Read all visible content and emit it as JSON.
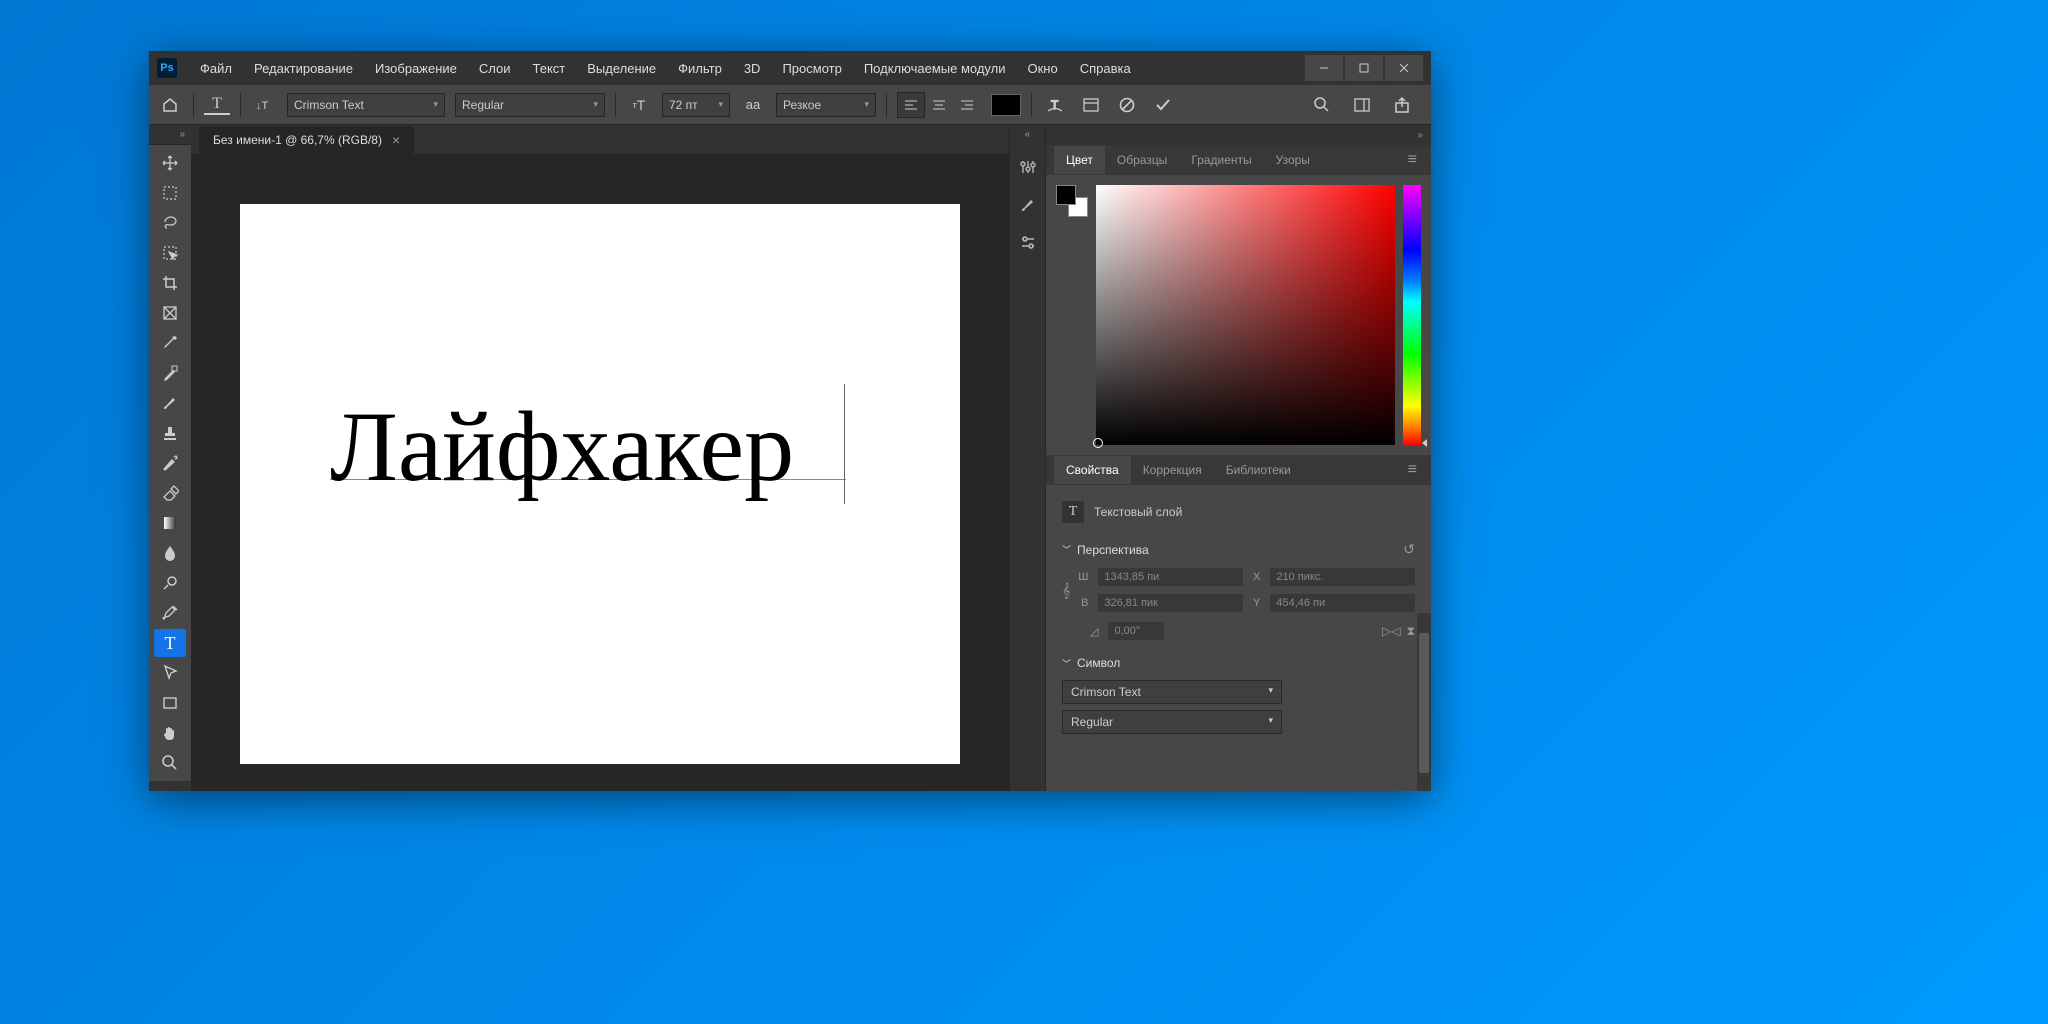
{
  "menu": [
    "Файл",
    "Редактирование",
    "Изображение",
    "Слои",
    "Текст",
    "Выделение",
    "Фильтр",
    "3D",
    "Просмотр",
    "Подключаемые модули",
    "Окно",
    "Справка"
  ],
  "options": {
    "font": "Crimson Text",
    "style": "Regular",
    "size": "72 пт",
    "size_label_prefix": "т",
    "size_label_suffix": "Т",
    "aa_label": "aа",
    "aa": "Резкое"
  },
  "tab": {
    "title": "Без имени-1 @ 66,7% (RGB/8)"
  },
  "canvas": {
    "text": "Лайфхакер"
  },
  "panels": {
    "color_tabs": [
      "Цвет",
      "Образцы",
      "Градиенты",
      "Узоры"
    ],
    "props_tabs": [
      "Свойства",
      "Коррекция",
      "Библиотеки"
    ],
    "props": {
      "type_label": "Текстовый слой",
      "perspective": "Перспектива",
      "w_label": "Ш",
      "w_val": "1343,85 пи",
      "h_label": "В",
      "h_val": "326,81 пик",
      "x_label": "X",
      "x_val": "210 пикс.",
      "y_label": "Y",
      "y_val": "454,46 пи",
      "rot_val": "0,00°",
      "symbol": "Символ",
      "sym_font": "Crimson Text",
      "sym_style": "Regular"
    }
  }
}
